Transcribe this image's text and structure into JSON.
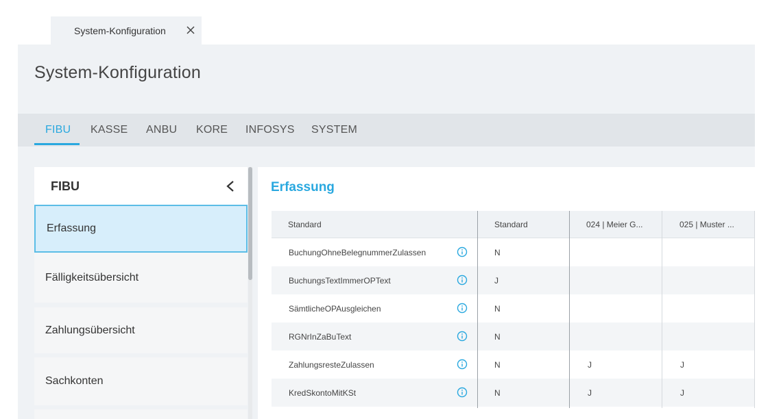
{
  "doc_tab": {
    "label": "System-Konfiguration"
  },
  "page": {
    "title": "System-Konfiguration"
  },
  "tabs": [
    {
      "label": "FIBU",
      "active": true
    },
    {
      "label": "KASSE"
    },
    {
      "label": "ANBU"
    },
    {
      "label": "KORE"
    },
    {
      "label": "INFOSYS"
    },
    {
      "label": "SYSTEM"
    }
  ],
  "sidebar": {
    "title": "FIBU",
    "items": [
      {
        "label": "Erfassung",
        "active": true
      },
      {
        "label": "Fälligkeitsübersicht"
      },
      {
        "label": "Zahlungsübersicht"
      },
      {
        "label": "Sachkonten"
      }
    ]
  },
  "section": {
    "title": "Erfassung"
  },
  "table": {
    "headers": [
      "Standard",
      "Standard",
      "024 | Meier G...",
      "025 | Muster ..."
    ],
    "rows": [
      {
        "name": "BuchungOhneBelegnummerZulassen",
        "standard": "N",
        "c1": "",
        "c2": ""
      },
      {
        "name": "BuchungsTextImmerOPText",
        "standard": "J",
        "c1": "",
        "c2": ""
      },
      {
        "name": "SämtlicheOPAusgleichen",
        "standard": "N",
        "c1": "",
        "c2": ""
      },
      {
        "name": "RGNrInZaBuText",
        "standard": "N",
        "c1": "",
        "c2": ""
      },
      {
        "name": "ZahlungsresteZulassen",
        "standard": "N",
        "c1": "J",
        "c2": "J"
      },
      {
        "name": "KredSkontoMitKSt",
        "standard": "N",
        "c1": "J",
        "c2": "J"
      }
    ]
  },
  "colors": {
    "accent": "#29a8df",
    "active_bg": "#d7eefb",
    "panel_bg": "#eff2f5"
  },
  "icons": {
    "close": "close-icon",
    "collapse": "chevron-left-icon",
    "info": "info-icon"
  }
}
